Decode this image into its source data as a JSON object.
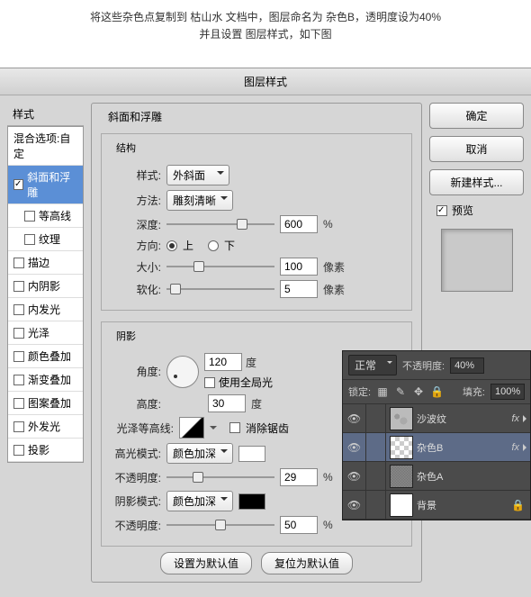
{
  "instruction_line1": "将这些杂色点复制到 枯山水 文档中，图层命名为 杂色B，透明度设为40%",
  "instruction_line2": "并且设置 图层样式，如下图",
  "dialog_title": "图层样式",
  "styles_header": "样式",
  "styles": {
    "blend_opts": "混合选项:自定",
    "bevel": "斜面和浮雕",
    "contour": "等高线",
    "texture": "纹理",
    "stroke": "描边",
    "inner_shadow": "内阴影",
    "inner_glow": "内发光",
    "satin": "光泽",
    "color_overlay": "颜色叠加",
    "grad_overlay": "渐变叠加",
    "pat_overlay": "图案叠加",
    "outer_glow": "外发光",
    "drop_shadow": "投影"
  },
  "bevel": {
    "group": "斜面和浮雕",
    "structure": "结构",
    "style_lbl": "样式:",
    "style_val": "外斜面",
    "tech_lbl": "方法:",
    "tech_val": "雕刻清晰",
    "depth_lbl": "深度:",
    "depth_val": "600",
    "depth_unit": "%",
    "dir_lbl": "方向:",
    "dir_up": "上",
    "dir_down": "下",
    "size_lbl": "大小:",
    "size_val": "100",
    "size_unit": "像素",
    "soften_lbl": "软化:",
    "soften_val": "5",
    "soften_unit": "像素"
  },
  "shading": {
    "group": "阴影",
    "angle_lbl": "角度:",
    "angle_val": "120",
    "angle_unit": "度",
    "global": "使用全局光",
    "alt_lbl": "高度:",
    "alt_val": "30",
    "alt_unit": "度",
    "gloss_lbl": "光泽等高线:",
    "anti": "消除锯齿",
    "hmode_lbl": "高光模式:",
    "hmode_val": "颜色加深",
    "hopac_lbl": "不透明度:",
    "hopac_val": "29",
    "hopac_unit": "%",
    "smode_lbl": "阴影模式:",
    "smode_val": "颜色加深",
    "sopac_lbl": "不透明度:",
    "sopac_val": "50",
    "sopac_unit": "%"
  },
  "defaults": {
    "set": "设置为默认值",
    "reset": "复位为默认值"
  },
  "buttons": {
    "ok": "确定",
    "cancel": "取消",
    "new_style": "新建样式...",
    "preview": "预览"
  },
  "layers": {
    "blend": "正常",
    "opac_lbl": "不透明度:",
    "opac_val": "40%",
    "lock_lbl": "锁定:",
    "fill_lbl": "填充:",
    "fill_val": "100%",
    "l0": "沙波纹",
    "l1": "杂色B",
    "l2": "杂色A",
    "l3": "背景"
  }
}
